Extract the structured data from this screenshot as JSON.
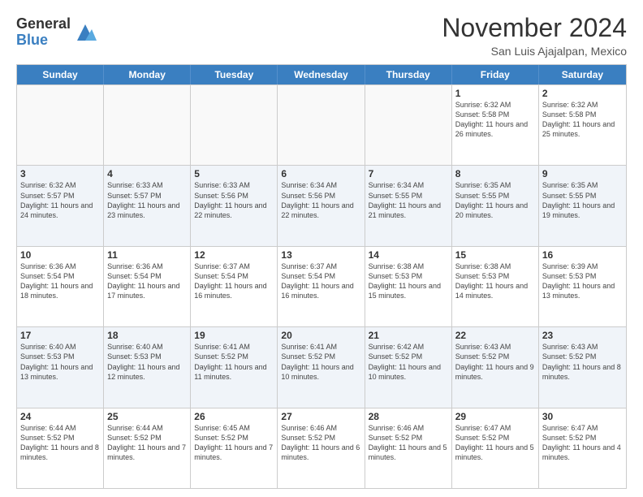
{
  "logo": {
    "general": "General",
    "blue": "Blue"
  },
  "title": "November 2024",
  "location": "San Luis Ajajalpan, Mexico",
  "days_of_week": [
    "Sunday",
    "Monday",
    "Tuesday",
    "Wednesday",
    "Thursday",
    "Friday",
    "Saturday"
  ],
  "rows": [
    [
      {
        "num": "",
        "info": ""
      },
      {
        "num": "",
        "info": ""
      },
      {
        "num": "",
        "info": ""
      },
      {
        "num": "",
        "info": ""
      },
      {
        "num": "",
        "info": ""
      },
      {
        "num": "1",
        "info": "Sunrise: 6:32 AM\nSunset: 5:58 PM\nDaylight: 11 hours and 26 minutes."
      },
      {
        "num": "2",
        "info": "Sunrise: 6:32 AM\nSunset: 5:58 PM\nDaylight: 11 hours and 25 minutes."
      }
    ],
    [
      {
        "num": "3",
        "info": "Sunrise: 6:32 AM\nSunset: 5:57 PM\nDaylight: 11 hours and 24 minutes."
      },
      {
        "num": "4",
        "info": "Sunrise: 6:33 AM\nSunset: 5:57 PM\nDaylight: 11 hours and 23 minutes."
      },
      {
        "num": "5",
        "info": "Sunrise: 6:33 AM\nSunset: 5:56 PM\nDaylight: 11 hours and 22 minutes."
      },
      {
        "num": "6",
        "info": "Sunrise: 6:34 AM\nSunset: 5:56 PM\nDaylight: 11 hours and 22 minutes."
      },
      {
        "num": "7",
        "info": "Sunrise: 6:34 AM\nSunset: 5:55 PM\nDaylight: 11 hours and 21 minutes."
      },
      {
        "num": "8",
        "info": "Sunrise: 6:35 AM\nSunset: 5:55 PM\nDaylight: 11 hours and 20 minutes."
      },
      {
        "num": "9",
        "info": "Sunrise: 6:35 AM\nSunset: 5:55 PM\nDaylight: 11 hours and 19 minutes."
      }
    ],
    [
      {
        "num": "10",
        "info": "Sunrise: 6:36 AM\nSunset: 5:54 PM\nDaylight: 11 hours and 18 minutes."
      },
      {
        "num": "11",
        "info": "Sunrise: 6:36 AM\nSunset: 5:54 PM\nDaylight: 11 hours and 17 minutes."
      },
      {
        "num": "12",
        "info": "Sunrise: 6:37 AM\nSunset: 5:54 PM\nDaylight: 11 hours and 16 minutes."
      },
      {
        "num": "13",
        "info": "Sunrise: 6:37 AM\nSunset: 5:54 PM\nDaylight: 11 hours and 16 minutes."
      },
      {
        "num": "14",
        "info": "Sunrise: 6:38 AM\nSunset: 5:53 PM\nDaylight: 11 hours and 15 minutes."
      },
      {
        "num": "15",
        "info": "Sunrise: 6:38 AM\nSunset: 5:53 PM\nDaylight: 11 hours and 14 minutes."
      },
      {
        "num": "16",
        "info": "Sunrise: 6:39 AM\nSunset: 5:53 PM\nDaylight: 11 hours and 13 minutes."
      }
    ],
    [
      {
        "num": "17",
        "info": "Sunrise: 6:40 AM\nSunset: 5:53 PM\nDaylight: 11 hours and 13 minutes."
      },
      {
        "num": "18",
        "info": "Sunrise: 6:40 AM\nSunset: 5:53 PM\nDaylight: 11 hours and 12 minutes."
      },
      {
        "num": "19",
        "info": "Sunrise: 6:41 AM\nSunset: 5:52 PM\nDaylight: 11 hours and 11 minutes."
      },
      {
        "num": "20",
        "info": "Sunrise: 6:41 AM\nSunset: 5:52 PM\nDaylight: 11 hours and 10 minutes."
      },
      {
        "num": "21",
        "info": "Sunrise: 6:42 AM\nSunset: 5:52 PM\nDaylight: 11 hours and 10 minutes."
      },
      {
        "num": "22",
        "info": "Sunrise: 6:43 AM\nSunset: 5:52 PM\nDaylight: 11 hours and 9 minutes."
      },
      {
        "num": "23",
        "info": "Sunrise: 6:43 AM\nSunset: 5:52 PM\nDaylight: 11 hours and 8 minutes."
      }
    ],
    [
      {
        "num": "24",
        "info": "Sunrise: 6:44 AM\nSunset: 5:52 PM\nDaylight: 11 hours and 8 minutes."
      },
      {
        "num": "25",
        "info": "Sunrise: 6:44 AM\nSunset: 5:52 PM\nDaylight: 11 hours and 7 minutes."
      },
      {
        "num": "26",
        "info": "Sunrise: 6:45 AM\nSunset: 5:52 PM\nDaylight: 11 hours and 7 minutes."
      },
      {
        "num": "27",
        "info": "Sunrise: 6:46 AM\nSunset: 5:52 PM\nDaylight: 11 hours and 6 minutes."
      },
      {
        "num": "28",
        "info": "Sunrise: 6:46 AM\nSunset: 5:52 PM\nDaylight: 11 hours and 5 minutes."
      },
      {
        "num": "29",
        "info": "Sunrise: 6:47 AM\nSunset: 5:52 PM\nDaylight: 11 hours and 5 minutes."
      },
      {
        "num": "30",
        "info": "Sunrise: 6:47 AM\nSunset: 5:52 PM\nDaylight: 11 hours and 4 minutes."
      }
    ]
  ]
}
